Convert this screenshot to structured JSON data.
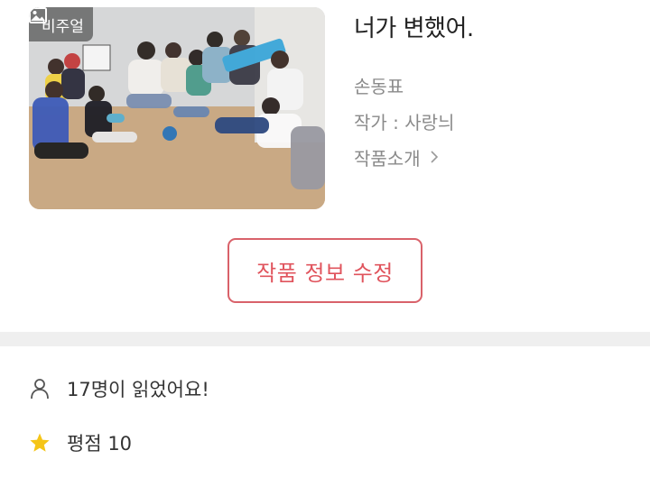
{
  "work": {
    "cover": {
      "badge_label": "비주얼",
      "badge_icon": "image-icon",
      "description": "group photo on wooden dance studio floor"
    },
    "title": "너가 변했어.",
    "subtitle": "손동표",
    "author_line": "작가 : 사랑늬",
    "intro_label": "작품소개",
    "intro_icon": "chevron-right-icon"
  },
  "actions": {
    "edit_label": "작품 정보 수정",
    "accent_color": "#e0545d"
  },
  "stats": {
    "reads_text": "17명이 읽었어요!",
    "reads_icon": "person-icon",
    "rating_text": "평점 10",
    "rating_icon": "star-icon",
    "rating_color": "#f5c518"
  }
}
